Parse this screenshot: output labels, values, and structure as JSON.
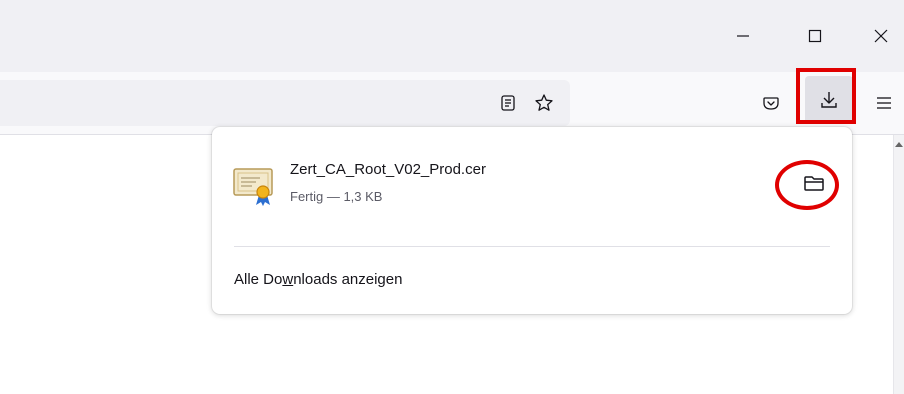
{
  "window": {
    "controls": [
      {
        "name": "minimize-icon"
      },
      {
        "name": "maximize-icon"
      },
      {
        "name": "close-icon"
      }
    ]
  },
  "toolbar": {
    "icons": [
      "reader-view-icon",
      "bookmark-star-icon",
      "pocket-icon",
      "download-icon",
      "menu-icon"
    ]
  },
  "downloads_panel": {
    "item": {
      "file_name": "Zert_CA_Root_V02_Prod.cer",
      "status": "Fertig — 1,3 KB",
      "icon": "certificate-icon",
      "action_icon": "folder-icon"
    },
    "show_all": {
      "before": "Alle Do",
      "accel": "w",
      "after": "nloads anzeigen"
    }
  },
  "highlights": {
    "color": "#e00000"
  }
}
